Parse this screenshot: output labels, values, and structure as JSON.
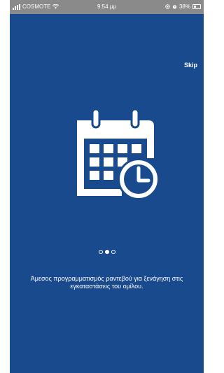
{
  "status_bar": {
    "carrier": "COSMOTE",
    "time": "9:54 μμ",
    "battery_percent": "38%",
    "battery_level": 0.38
  },
  "onboarding": {
    "skip_label": "Skip",
    "illustration_icon": "calendar-clock-icon",
    "page_count": 3,
    "current_page": 2,
    "description": "Άμεσος προγραμματισμός ραντεβού για ξενάγηση στις εγκαταστάσεις του ομίλου."
  },
  "colors": {
    "background": "#1a4a8e",
    "status_bar": "#8a8a8a",
    "foreground": "#ffffff"
  }
}
